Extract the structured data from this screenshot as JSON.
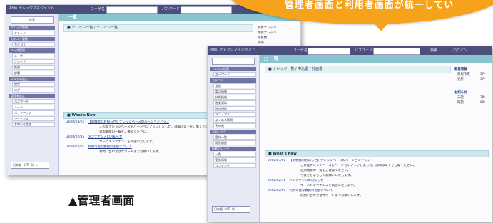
{
  "callout": {
    "text": "管理者画面と利用者画面が統一してい",
    "color": "#f6a21a"
  },
  "caption": "▲管理者画面",
  "admin_window": {
    "app_label": "Ablu ナレッジマネジメント",
    "topbar_label_1": "ユーザ名",
    "topbar_label_2": "パスワード",
    "search_label": "検索",
    "sidebar": {
      "sections": [
        {
          "label": "ナレッジ管理",
          "items": [
            "ナレッジ"
          ]
        },
        {
          "label": "カテゴリ管理",
          "items": [
            "カテゴリ"
          ]
        },
        {
          "label": "ユーザ管理",
          "items": [
            "ユーザ",
            "グループ",
            "権限",
            "部署"
          ]
        },
        {
          "label": "システム設定",
          "items": [
            "設定",
            "ログ"
          ]
        },
        {
          "label": "管理者設定",
          "items": [
            "パスワード",
            "メール",
            "バックアップ",
            "ライセンス",
            "お知らせ管理"
          ]
        }
      ],
      "select_value": "日本語（UTF-8）"
    },
    "pane_title": "□ 一覧",
    "breadcrumb": "■ ナレッジ一覧 / ナレッジ一覧",
    "right_panel": [
      "新着ナレッジ",
      "更新ナレッジ",
      "閲覧数",
      "評価"
    ],
    "info_title": "■ What's New",
    "info_lines": [
      {
        "date": "2008/03/01",
        "text": "【新機能のお知らせ】ナレッジベースのバージョンアップ"
      },
      {
        "date": "",
        "text": "この度ナレッジベースをバージョンアップしました。詳細は以下をご覧ください。"
      },
      {
        "date": "",
        "text": "追加機能の一覧をご確認ください。"
      },
      {
        "date": "2008/02/15",
        "text": "メンテナンスのお知らせ"
      },
      {
        "date": "",
        "text": "サーバメンテナンスを実施いたします。"
      },
      {
        "date": "2008/02/01",
        "text": "利用可能な機能の追加について"
      },
      {
        "date": "",
        "text": "お問い合わせはサポートまでお願いします。"
      }
    ]
  },
  "user_window": {
    "app_label": "Ablu ナレッジマネジメント",
    "topbar_label_1": "ユーザ名",
    "topbar_label_2": "パスワード",
    "btn_1": "検索",
    "btn_2": "ログイン",
    "sidebar": {
      "sections": [
        {
          "label": "ナレッジ検索",
          "items": [
            "キーワード"
          ]
        },
        {
          "label": "カテゴリ",
          "items": [
            "全般",
            "製品情報",
            "技術情報",
            "営業資料",
            "社内規程",
            "マニュアル",
            "よくある質問",
            "その他"
          ]
        },
        {
          "label": "お気に入り",
          "items": [
            "登録一覧",
            "閲覧履歴"
          ]
        },
        {
          "label": "新着ナレッジ",
          "items": [
            "一覧",
            "更新情報",
            "ランキング"
          ]
        }
      ],
      "select_value": "日本語（UTF-8）"
    },
    "pane_title": "□ 一覧",
    "breadcrumb": "■ ナレッジ一覧 / 申込書 / 計画書",
    "right_panel": [
      {
        "head": "新着情報",
        "rows": [
          [
            "新規作成",
            "3件"
          ],
          [
            "更新",
            "5件"
          ]
        ]
      },
      {
        "head": "お知らせ",
        "rows": [
          [
            "未読",
            "2件"
          ],
          [
            "既読",
            "8件"
          ]
        ]
      }
    ],
    "info_title": "■ What's New",
    "info_lines": [
      {
        "date": "2008/03/01",
        "text": "【新機能のお知らせ】ナレッジベースのバージョンアップ"
      },
      {
        "date": "",
        "text": "この度ナレッジベースをバージョンアップしました。詳細は以下をご覧ください。"
      },
      {
        "date": "",
        "text": "追加機能の一覧をご確認ください。"
      },
      {
        "date": "",
        "text": "今後ともよろしくお願いいたします。"
      },
      {
        "date": "2008/02/15",
        "text": "メンテナンスのお知らせ"
      },
      {
        "date": "",
        "text": "サーバメンテナンスを実施いたします。"
      },
      {
        "date": "2008/02/01",
        "text": "利用可能な機能の追加について"
      },
      {
        "date": "",
        "text": "お問い合わせはサポートまでお願いします。"
      }
    ]
  }
}
